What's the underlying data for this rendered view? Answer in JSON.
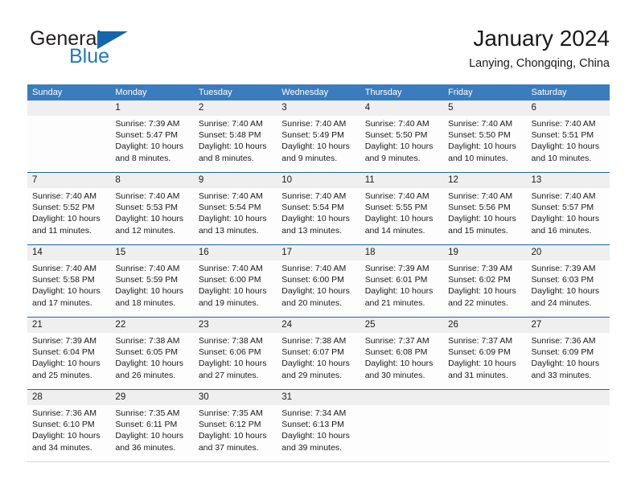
{
  "brand": {
    "name_part1": "General",
    "name_part2": "Blue",
    "triangle_icon": "triangle-icon"
  },
  "header": {
    "title": "January 2024",
    "subtitle": "Lanying, Chongqing, China"
  },
  "colors": {
    "header_blue": "#3a7cbe",
    "week_divider_blue": "#1f63a8",
    "daynum_band": "#efefef",
    "brand_blue": "#2279c0",
    "brand_dark": "#231f20"
  },
  "weekdays": [
    "Sunday",
    "Monday",
    "Tuesday",
    "Wednesday",
    "Thursday",
    "Friday",
    "Saturday"
  ],
  "weeks": [
    {
      "days": [
        {
          "num": "",
          "sunrise": "",
          "sunset": "",
          "daylight_a": "",
          "daylight_b": ""
        },
        {
          "num": "1",
          "sunrise": "Sunrise: 7:39 AM",
          "sunset": "Sunset: 5:47 PM",
          "daylight_a": "Daylight: 10 hours",
          "daylight_b": "and 8 minutes."
        },
        {
          "num": "2",
          "sunrise": "Sunrise: 7:40 AM",
          "sunset": "Sunset: 5:48 PM",
          "daylight_a": "Daylight: 10 hours",
          "daylight_b": "and 8 minutes."
        },
        {
          "num": "3",
          "sunrise": "Sunrise: 7:40 AM",
          "sunset": "Sunset: 5:49 PM",
          "daylight_a": "Daylight: 10 hours",
          "daylight_b": "and 9 minutes."
        },
        {
          "num": "4",
          "sunrise": "Sunrise: 7:40 AM",
          "sunset": "Sunset: 5:50 PM",
          "daylight_a": "Daylight: 10 hours",
          "daylight_b": "and 9 minutes."
        },
        {
          "num": "5",
          "sunrise": "Sunrise: 7:40 AM",
          "sunset": "Sunset: 5:50 PM",
          "daylight_a": "Daylight: 10 hours",
          "daylight_b": "and 10 minutes."
        },
        {
          "num": "6",
          "sunrise": "Sunrise: 7:40 AM",
          "sunset": "Sunset: 5:51 PM",
          "daylight_a": "Daylight: 10 hours",
          "daylight_b": "and 10 minutes."
        }
      ]
    },
    {
      "days": [
        {
          "num": "7",
          "sunrise": "Sunrise: 7:40 AM",
          "sunset": "Sunset: 5:52 PM",
          "daylight_a": "Daylight: 10 hours",
          "daylight_b": "and 11 minutes."
        },
        {
          "num": "8",
          "sunrise": "Sunrise: 7:40 AM",
          "sunset": "Sunset: 5:53 PM",
          "daylight_a": "Daylight: 10 hours",
          "daylight_b": "and 12 minutes."
        },
        {
          "num": "9",
          "sunrise": "Sunrise: 7:40 AM",
          "sunset": "Sunset: 5:54 PM",
          "daylight_a": "Daylight: 10 hours",
          "daylight_b": "and 13 minutes."
        },
        {
          "num": "10",
          "sunrise": "Sunrise: 7:40 AM",
          "sunset": "Sunset: 5:54 PM",
          "daylight_a": "Daylight: 10 hours",
          "daylight_b": "and 13 minutes."
        },
        {
          "num": "11",
          "sunrise": "Sunrise: 7:40 AM",
          "sunset": "Sunset: 5:55 PM",
          "daylight_a": "Daylight: 10 hours",
          "daylight_b": "and 14 minutes."
        },
        {
          "num": "12",
          "sunrise": "Sunrise: 7:40 AM",
          "sunset": "Sunset: 5:56 PM",
          "daylight_a": "Daylight: 10 hours",
          "daylight_b": "and 15 minutes."
        },
        {
          "num": "13",
          "sunrise": "Sunrise: 7:40 AM",
          "sunset": "Sunset: 5:57 PM",
          "daylight_a": "Daylight: 10 hours",
          "daylight_b": "and 16 minutes."
        }
      ]
    },
    {
      "days": [
        {
          "num": "14",
          "sunrise": "Sunrise: 7:40 AM",
          "sunset": "Sunset: 5:58 PM",
          "daylight_a": "Daylight: 10 hours",
          "daylight_b": "and 17 minutes."
        },
        {
          "num": "15",
          "sunrise": "Sunrise: 7:40 AM",
          "sunset": "Sunset: 5:59 PM",
          "daylight_a": "Daylight: 10 hours",
          "daylight_b": "and 18 minutes."
        },
        {
          "num": "16",
          "sunrise": "Sunrise: 7:40 AM",
          "sunset": "Sunset: 6:00 PM",
          "daylight_a": "Daylight: 10 hours",
          "daylight_b": "and 19 minutes."
        },
        {
          "num": "17",
          "sunrise": "Sunrise: 7:40 AM",
          "sunset": "Sunset: 6:00 PM",
          "daylight_a": "Daylight: 10 hours",
          "daylight_b": "and 20 minutes."
        },
        {
          "num": "18",
          "sunrise": "Sunrise: 7:39 AM",
          "sunset": "Sunset: 6:01 PM",
          "daylight_a": "Daylight: 10 hours",
          "daylight_b": "and 21 minutes."
        },
        {
          "num": "19",
          "sunrise": "Sunrise: 7:39 AM",
          "sunset": "Sunset: 6:02 PM",
          "daylight_a": "Daylight: 10 hours",
          "daylight_b": "and 22 minutes."
        },
        {
          "num": "20",
          "sunrise": "Sunrise: 7:39 AM",
          "sunset": "Sunset: 6:03 PM",
          "daylight_a": "Daylight: 10 hours",
          "daylight_b": "and 24 minutes."
        }
      ]
    },
    {
      "days": [
        {
          "num": "21",
          "sunrise": "Sunrise: 7:39 AM",
          "sunset": "Sunset: 6:04 PM",
          "daylight_a": "Daylight: 10 hours",
          "daylight_b": "and 25 minutes."
        },
        {
          "num": "22",
          "sunrise": "Sunrise: 7:38 AM",
          "sunset": "Sunset: 6:05 PM",
          "daylight_a": "Daylight: 10 hours",
          "daylight_b": "and 26 minutes."
        },
        {
          "num": "23",
          "sunrise": "Sunrise: 7:38 AM",
          "sunset": "Sunset: 6:06 PM",
          "daylight_a": "Daylight: 10 hours",
          "daylight_b": "and 27 minutes."
        },
        {
          "num": "24",
          "sunrise": "Sunrise: 7:38 AM",
          "sunset": "Sunset: 6:07 PM",
          "daylight_a": "Daylight: 10 hours",
          "daylight_b": "and 29 minutes."
        },
        {
          "num": "25",
          "sunrise": "Sunrise: 7:37 AM",
          "sunset": "Sunset: 6:08 PM",
          "daylight_a": "Daylight: 10 hours",
          "daylight_b": "and 30 minutes."
        },
        {
          "num": "26",
          "sunrise": "Sunrise: 7:37 AM",
          "sunset": "Sunset: 6:09 PM",
          "daylight_a": "Daylight: 10 hours",
          "daylight_b": "and 31 minutes."
        },
        {
          "num": "27",
          "sunrise": "Sunrise: 7:36 AM",
          "sunset": "Sunset: 6:09 PM",
          "daylight_a": "Daylight: 10 hours",
          "daylight_b": "and 33 minutes."
        }
      ]
    },
    {
      "days": [
        {
          "num": "28",
          "sunrise": "Sunrise: 7:36 AM",
          "sunset": "Sunset: 6:10 PM",
          "daylight_a": "Daylight: 10 hours",
          "daylight_b": "and 34 minutes."
        },
        {
          "num": "29",
          "sunrise": "Sunrise: 7:35 AM",
          "sunset": "Sunset: 6:11 PM",
          "daylight_a": "Daylight: 10 hours",
          "daylight_b": "and 36 minutes."
        },
        {
          "num": "30",
          "sunrise": "Sunrise: 7:35 AM",
          "sunset": "Sunset: 6:12 PM",
          "daylight_a": "Daylight: 10 hours",
          "daylight_b": "and 37 minutes."
        },
        {
          "num": "31",
          "sunrise": "Sunrise: 7:34 AM",
          "sunset": "Sunset: 6:13 PM",
          "daylight_a": "Daylight: 10 hours",
          "daylight_b": "and 39 minutes."
        },
        {
          "num": "",
          "sunrise": "",
          "sunset": "",
          "daylight_a": "",
          "daylight_b": ""
        },
        {
          "num": "",
          "sunrise": "",
          "sunset": "",
          "daylight_a": "",
          "daylight_b": ""
        },
        {
          "num": "",
          "sunrise": "",
          "sunset": "",
          "daylight_a": "",
          "daylight_b": ""
        }
      ]
    }
  ]
}
